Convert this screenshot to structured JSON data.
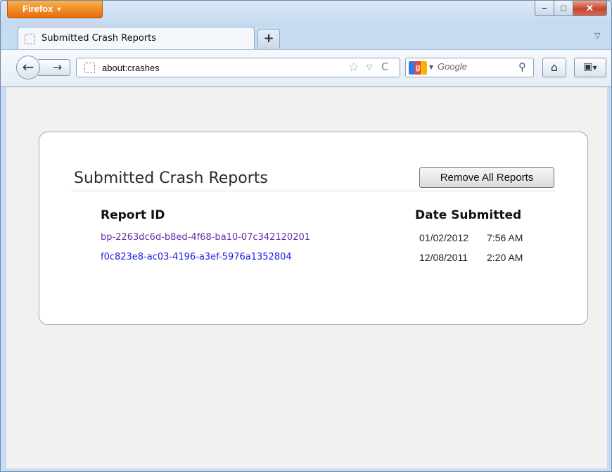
{
  "browser": {
    "app_menu_label": "Firefox",
    "app_menu_arrow": "▼",
    "window_controls": {
      "minimize": "–",
      "maximize": "□",
      "close": "✕"
    }
  },
  "tabs": [
    {
      "label": "Submitted Crash Reports",
      "active": true
    }
  ],
  "new_tab_label": "+",
  "tab_list_arrow": "▽",
  "navbar": {
    "back_icon": "back-arrow-icon",
    "forward_icon": "forward-arrow-icon",
    "url": "about:crashes",
    "search_engine": "Google",
    "search_placeholder": "Google",
    "icons": {
      "back": "←",
      "forward": "→",
      "star": "☆",
      "dropdown": "▽",
      "reload": "C",
      "magnifier": "⚲",
      "home": "⌂",
      "bookmarks": "▣"
    }
  },
  "page": {
    "title": "Submitted Crash Reports",
    "remove_all_label": "Remove All Reports",
    "columns": {
      "report_id": "Report ID",
      "date_submitted": "Date Submitted"
    },
    "reports": [
      {
        "id": "bp-2263dc6d-b8ed-4f68-ba10-07c342120201",
        "date": "01/02/2012",
        "time": "7:56 AM",
        "link_color": "#6b2aa7"
      },
      {
        "id": "f0c823e8-ac03-4196-a3ef-5976a1352804",
        "date": "12/08/2011",
        "time": "2:20 AM",
        "link_color": "#1a1ae6"
      }
    ]
  }
}
